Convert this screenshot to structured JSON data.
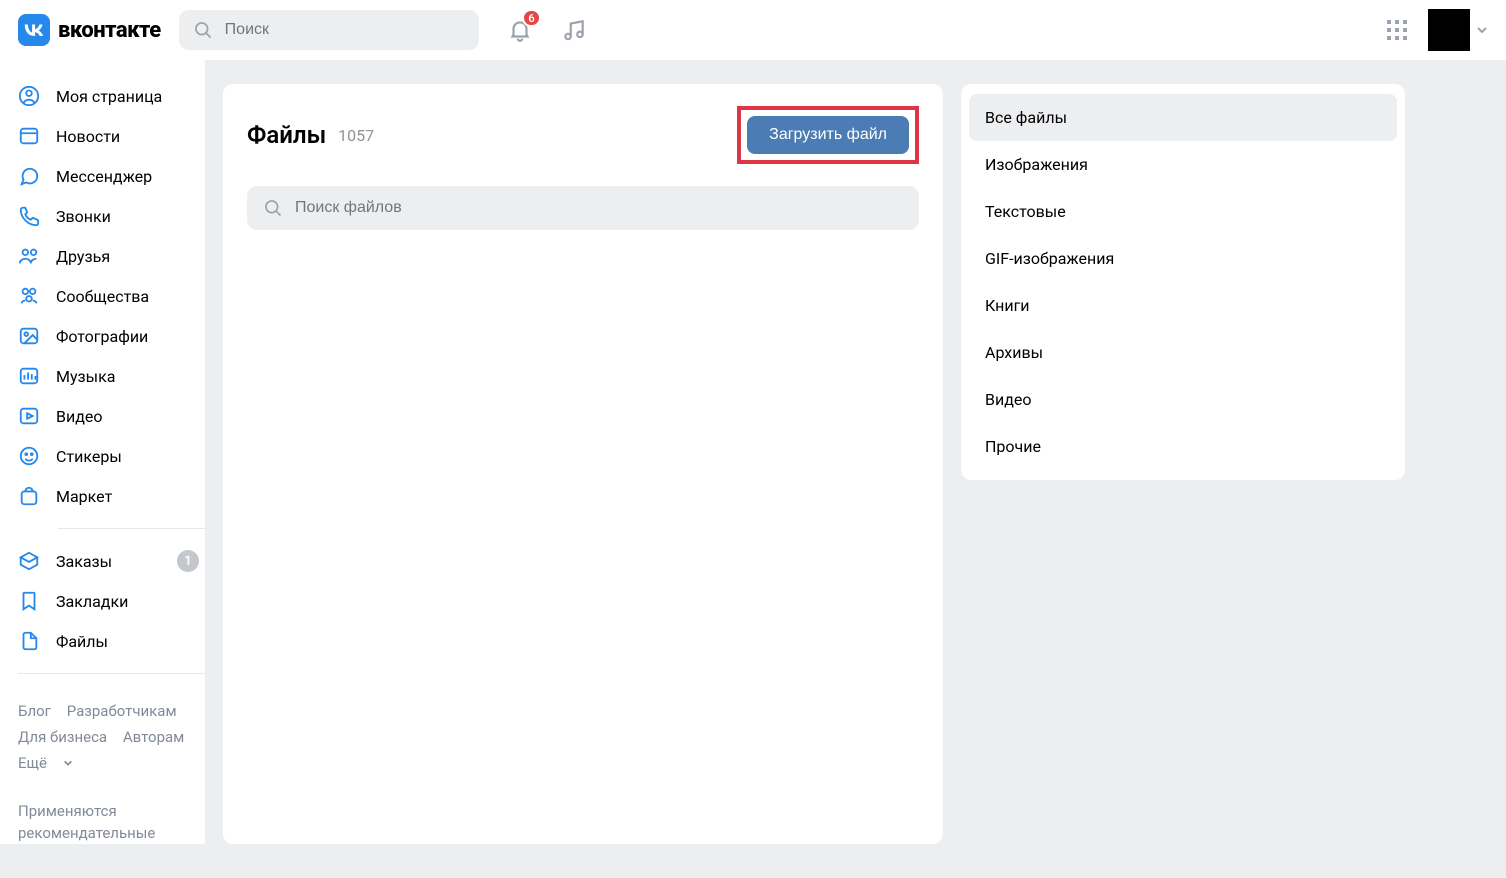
{
  "header": {
    "logo_text": "вконтакте",
    "search_placeholder": "Поиск",
    "notif_count": "6"
  },
  "sidebar": {
    "items": [
      {
        "label": "Моя страница"
      },
      {
        "label": "Новости"
      },
      {
        "label": "Мессенджер"
      },
      {
        "label": "Звонки"
      },
      {
        "label": "Друзья"
      },
      {
        "label": "Сообщества"
      },
      {
        "label": "Фотографии"
      },
      {
        "label": "Музыка"
      },
      {
        "label": "Видео"
      },
      {
        "label": "Стикеры"
      },
      {
        "label": "Маркет"
      }
    ],
    "items2": [
      {
        "label": "Заказы",
        "badge": "1"
      },
      {
        "label": "Закладки"
      },
      {
        "label": "Файлы"
      }
    ],
    "footer": {
      "blog": "Блог",
      "devs": "Разработчикам",
      "business": "Для бизнеса",
      "authors": "Авторам",
      "more": "Ещё"
    },
    "note1": "Применяются",
    "note2": "рекомендательные"
  },
  "content": {
    "title": "Файлы",
    "count": "1057",
    "upload_label": "Загрузить файл",
    "search_placeholder": "Поиск файлов"
  },
  "aside": {
    "items": [
      "Все файлы",
      "Изображения",
      "Текстовые",
      "GIF-изображения",
      "Книги",
      "Архивы",
      "Видео",
      "Прочие"
    ]
  }
}
